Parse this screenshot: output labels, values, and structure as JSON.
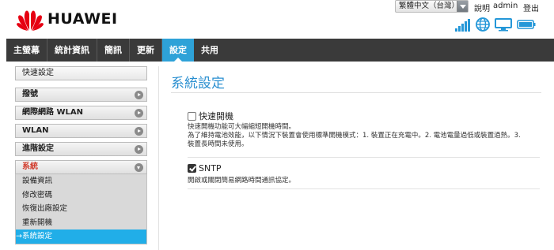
{
  "brand": {
    "name": "HUAWEI",
    "logo_color": "#e60012"
  },
  "header": {
    "language": "繁體中文（台灣）",
    "help": "說明",
    "user": "admin",
    "logout": "登出"
  },
  "status_icons": [
    "signal-icon",
    "globe-icon",
    "monitor-icon",
    "battery-icon"
  ],
  "nav": {
    "items": [
      "主螢幕",
      "統計資訊",
      "簡訊",
      "更新",
      "設定",
      "共用"
    ],
    "active": "設定"
  },
  "sidebar": {
    "quick_setup": "快速設定",
    "items": [
      "撥號",
      "網際網路 WLAN",
      "WLAN",
      "進階設定",
      "系統"
    ],
    "system_sub": [
      "設備資訊",
      "修改密碼",
      "恢復出廠設定",
      "重新開機",
      "→系統設定"
    ]
  },
  "main": {
    "title": "系統設定",
    "fast_boot": {
      "label": "快速開機",
      "checked": false,
      "desc_line1": "快速開機功能可大幅縮短開機時間。",
      "desc_line2": "為了維持電池效能，以下情況下裝置會使用標準開機模式：1. 裝置正在充電中。2. 電池電量過低或裝置過熱。3.",
      "desc_line3": "裝置長時間未使用。"
    },
    "sntp": {
      "label": "SNTP",
      "checked": true,
      "desc": "開啟或關閉簡易網路時間通訊協定。"
    }
  },
  "colors": {
    "accent": "#2ea2d8",
    "nav_bg": "#3a3a3a",
    "active_sub": "#21aee8",
    "open_item": "#d13a2a"
  }
}
